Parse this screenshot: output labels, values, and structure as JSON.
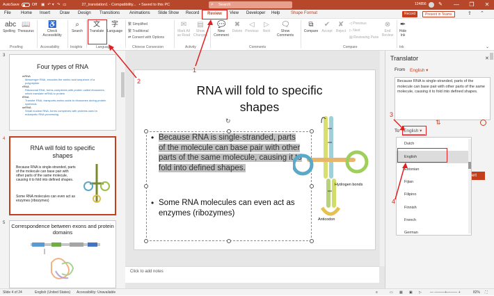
{
  "titlebar": {
    "autosave": "AutoSave",
    "off": "Off",
    "filename": "27_translation1 - Compatibility...",
    "saved": "• Saved to this PC",
    "search": "Search",
    "user": "124856",
    "minimize": "—",
    "restore": "❐",
    "close": "✕"
  },
  "menu": {
    "tabs": [
      "File",
      "Home",
      "Insert",
      "Draw",
      "Design",
      "Transitions",
      "Animations",
      "Slide Show",
      "Record",
      "Review",
      "View",
      "Developer",
      "Help",
      "Shape Format"
    ],
    "record": "Record",
    "present": "Present in Teams"
  },
  "ribbon": {
    "spelling": "Spelling",
    "thesaurus": "Thesaurus",
    "proofing": "Proofing",
    "check_accessibility": "Check Accessibility",
    "accessibility": "Accessibility",
    "search": "Search",
    "insights": "Insights",
    "translate": "Translate",
    "language": "Language",
    "language_group": "Language",
    "simplified": "Simplified",
    "traditional": "Traditional",
    "convert": "Convert with Options",
    "chinese_conversion": "Chinese Conversion",
    "mark_all": "Mark All as Read",
    "show_changes": "Show Changes",
    "activity": "Activity",
    "new_comment": "New Comment",
    "delete": "Delete",
    "previous": "Previous",
    "next": "Next",
    "show_comments": "Show Comments",
    "comments": "Comments",
    "compare": "Compare",
    "accept": "Accept",
    "reject": "Reject",
    "prev2": "Previous",
    "next2": "Next",
    "reviewing_pane": "Reviewing Pane",
    "end_review": "End Review",
    "compare_group": "Compare",
    "hide_ink": "Hide Ink",
    "ink": "Ink"
  },
  "thumbnails": {
    "slide3_num": "3",
    "slide3_title": "Four types of RNA",
    "slide3_items": [
      "mRNA",
      "Messenger RNA, encodes the amino acid sequence of a polypeptide",
      "rRNA",
      "Ribosomal RNA, forms complexes with protein called ribosomes, which translate mRNA to protein",
      "tRNA",
      "Transfer RNA, transports amino acids to ribosomes during protein synthesis",
      "snRNA",
      "Small nuclear RNA, forms complexes with proteins used in eukaryotic RNA processing"
    ],
    "slide4_num": "4",
    "slide4_title": "RNA will fold to specific shapes",
    "slide4_b1": "Because RNA is single-stranded, parts of the molecule can base pair with other parts of the same molecule, causing it to fold into defined shapes.",
    "slide4_b2": "Some RNA molecules can even act as enzymes (ribozymes)",
    "slide5_num": "5",
    "slide5_title": "Correspondence between exons and protein domains"
  },
  "slide": {
    "title": "RNA will fold to specific shapes",
    "bullet1": "Because RNA is single-stranded, parts of the molecule can base pair with other parts of the same molecule, causing it to fold into defined shapes.",
    "bullet2": "Some RNA molecules can even act as enzymes (ribozymes)",
    "hydrogen": "Hydrogen bonds",
    "anticodon": "Anticodon",
    "notes": "Click to add notes"
  },
  "translator": {
    "title": "Translator",
    "close": "✕",
    "from_label": "From",
    "from_value": "English",
    "source_text": "Because RNA is single-stranded, parts of the molecule can base pair with other parts of the same molecule, causing it to fold into defined shapes.",
    "to_label": "To",
    "to_value": "English",
    "swap": "⇅",
    "insert": "ert",
    "options": [
      "Dutch",
      "English",
      "Estonian",
      "Fijian",
      "Filipino",
      "Finnish",
      "French",
      "German"
    ]
  },
  "status": {
    "slide": "Slide 4 of 24",
    "language": "English (United States)",
    "accessibility": "Accessibility: Unavailable",
    "zoom": "82%"
  },
  "annotations": [
    "1",
    "2",
    "3",
    "4"
  ],
  "colors": {
    "brand": "#b7472a",
    "annotation": "#e02020"
  }
}
